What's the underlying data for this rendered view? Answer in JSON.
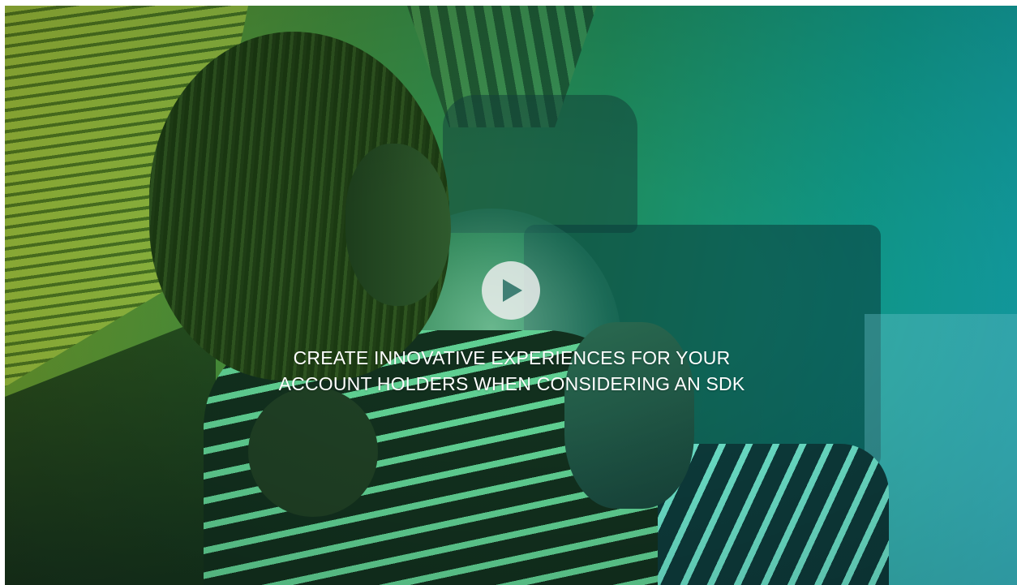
{
  "video": {
    "headline_line1": "CREATE INNOVATIVE EXPERIENCES FOR YOUR",
    "headline_line2": "ACCOUNT HOLDERS WHEN CONSIDERING AN SDK",
    "play_icon": "play-icon"
  },
  "colors": {
    "gradient_start": "#6f9a2a",
    "gradient_mid": "#1f8a5a",
    "gradient_end": "#14a8b2",
    "text": "#ffffff",
    "play_button_bg": "#f0f0f0",
    "play_icon": "#3f7f74"
  }
}
